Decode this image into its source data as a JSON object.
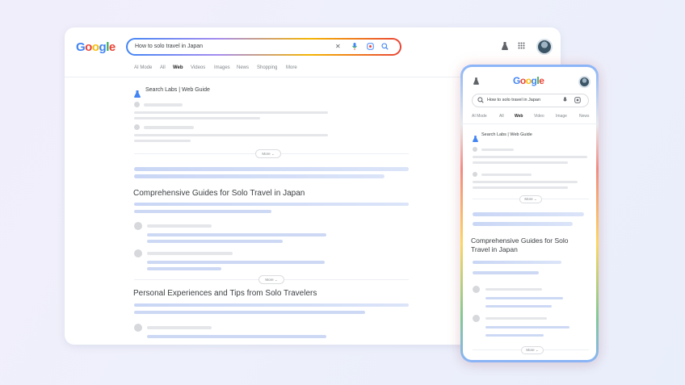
{
  "desktop": {
    "logo": "Google",
    "search_query": "How to solo travel in Japan",
    "tabs": [
      "AI Mode",
      "All",
      "Web",
      "Videos",
      "Images",
      "News",
      "Shopping",
      "More"
    ],
    "active_tab": "Web",
    "web_guide_title": "Search Labs | Web Guide",
    "more_label": "More",
    "section1_heading": "Comprehensive Guides for Solo Travel in Japan",
    "section2_heading": "Personal Experiences and Tips from Solo Travelers"
  },
  "phone": {
    "logo": "Google",
    "search_query": "How to solo travel in Japan",
    "tabs": [
      "AI Mode",
      "All",
      "Web",
      "Video",
      "Image",
      "News"
    ],
    "active_tab": "Web",
    "web_guide_title": "Search Labs | Web Guide",
    "more_label": "More",
    "section1_heading_line1": "Comprehensive Guides for Solo",
    "section1_heading_line2": "Travel in Japan"
  },
  "colors": {
    "google_blue": "#4285f4",
    "google_red": "#ea4335",
    "google_yellow": "#fbbc05",
    "google_green": "#34a853"
  },
  "icons": [
    "close-icon",
    "mic-icon",
    "lens-icon",
    "search-icon",
    "labs-flask-icon",
    "apps-grid-icon",
    "avatar"
  ]
}
